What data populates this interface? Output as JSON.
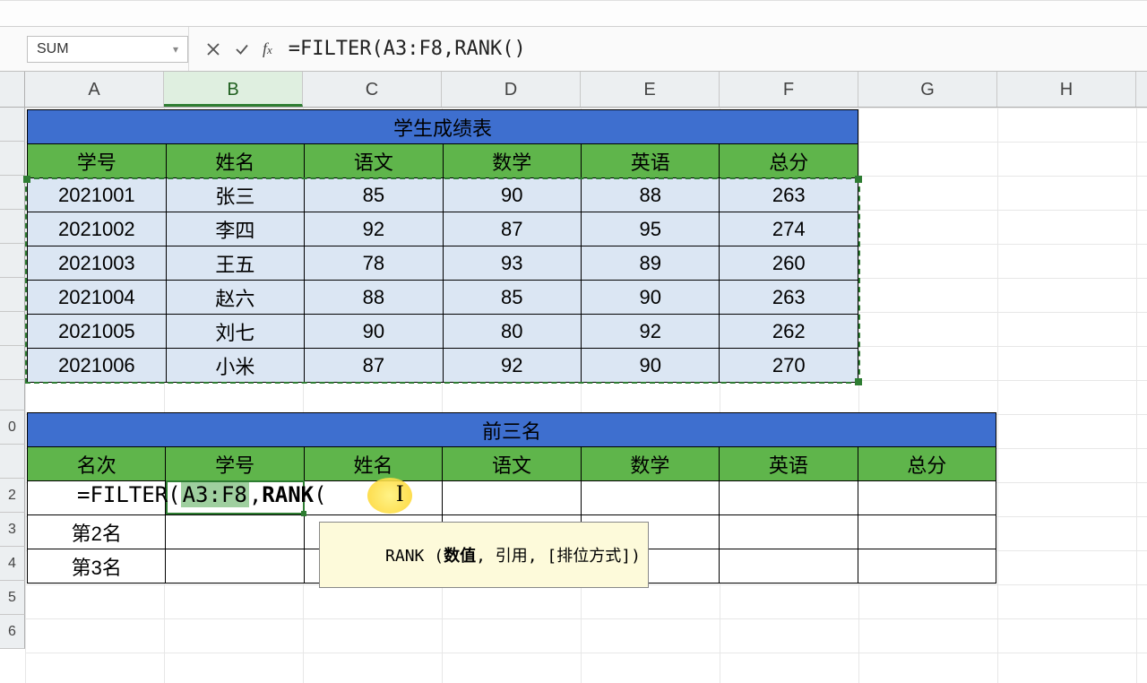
{
  "name_box": {
    "value": "SUM"
  },
  "formula_bar": {
    "formula": "=FILTER(A3:F8,RANK()"
  },
  "columns": [
    "A",
    "B",
    "C",
    "D",
    "E",
    "F",
    "G",
    "H"
  ],
  "row_numbers_visible": [
    "0",
    "2",
    "3",
    "4",
    "5",
    "6"
  ],
  "student_table": {
    "title": "学生成绩表",
    "headers": [
      "学号",
      "姓名",
      "语文",
      "数学",
      "英语",
      "总分"
    ],
    "rows": [
      [
        "2021001",
        "张三",
        "85",
        "90",
        "88",
        "263"
      ],
      [
        "2021002",
        "李四",
        "92",
        "87",
        "95",
        "274"
      ],
      [
        "2021003",
        "王五",
        "78",
        "93",
        "89",
        "260"
      ],
      [
        "2021004",
        "赵六",
        "88",
        "85",
        "90",
        "263"
      ],
      [
        "2021005",
        "刘七",
        "90",
        "80",
        "92",
        "262"
      ],
      [
        "2021006",
        "小米",
        "87",
        "92",
        "90",
        "270"
      ]
    ]
  },
  "top3_table": {
    "title": "前三名",
    "headers": [
      "名次",
      "学号",
      "姓名",
      "语文",
      "数学",
      "英语",
      "总分"
    ],
    "rank_labels": [
      "",
      "第2名",
      "第3名"
    ]
  },
  "cell_edit": {
    "prefix": "=FILTER(",
    "ref": "A3:F8",
    "mid": ",",
    "fn": "RANK",
    "suffix": "("
  },
  "tooltip": {
    "fn": "RANK",
    "open": " (",
    "arg1": "数值",
    "rest": ", 引用, [排位方式])"
  },
  "chart_data": {
    "type": "table",
    "title": "学生成绩表",
    "columns": [
      "学号",
      "姓名",
      "语文",
      "数学",
      "英语",
      "总分"
    ],
    "rows": [
      {
        "学号": 2021001,
        "姓名": "张三",
        "语文": 85,
        "数学": 90,
        "英语": 88,
        "总分": 263
      },
      {
        "学号": 2021002,
        "姓名": "李四",
        "语文": 92,
        "数学": 87,
        "英语": 95,
        "总分": 274
      },
      {
        "学号": 2021003,
        "姓名": "王五",
        "语文": 78,
        "数学": 93,
        "英语": 89,
        "总分": 260
      },
      {
        "学号": 2021004,
        "姓名": "赵六",
        "语文": 88,
        "数学": 85,
        "英语": 90,
        "总分": 263
      },
      {
        "学号": 2021005,
        "姓名": "刘七",
        "语文": 90,
        "数学": 80,
        "英语": 92,
        "总分": 262
      },
      {
        "学号": 2021006,
        "姓名": "小米",
        "语文": 87,
        "数学": 92,
        "英语": 90,
        "总分": 270
      }
    ]
  }
}
